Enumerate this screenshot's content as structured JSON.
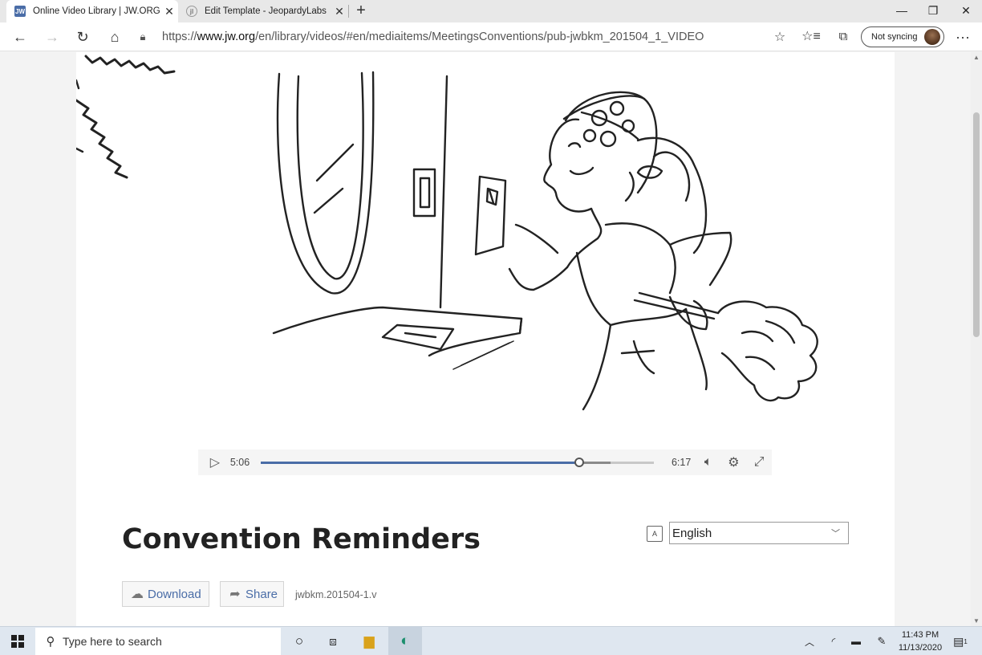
{
  "browser": {
    "tabs": [
      {
        "title": "Online Video Library | JW.ORG Vi",
        "favicon": "JW"
      },
      {
        "title": "Edit Template - JeopardyLabs",
        "favicon": "jl"
      }
    ],
    "url_prefix": "https://",
    "url_domain": "www.jw.org",
    "url_path": "/en/library/videos/#en/mediaitems/MeetingsConventions/pub-jwbkm_201504_1_VIDEO",
    "profile_label": "Not syncing",
    "icons": [
      "back-icon",
      "forward-icon",
      "refresh-icon",
      "home-icon",
      "lock-icon",
      "favorite-star-icon",
      "favorites-list-icon",
      "collections-icon",
      "more-icon"
    ]
  },
  "player": {
    "current_time": "5:06",
    "duration": "6:17",
    "progress_fraction": 0.81,
    "buffered_fraction": 0.89,
    "accent": "#4a6da7"
  },
  "video_info": {
    "title": "Convention Reminders",
    "language": "English",
    "download_label": "Download",
    "share_label": "Share",
    "pub_code": "jwbkm.201504-1.v"
  },
  "taskbar": {
    "search_placeholder": "Type here to search",
    "time": "11:43 PM",
    "date": "11/13/2020",
    "notification_count": "1"
  }
}
